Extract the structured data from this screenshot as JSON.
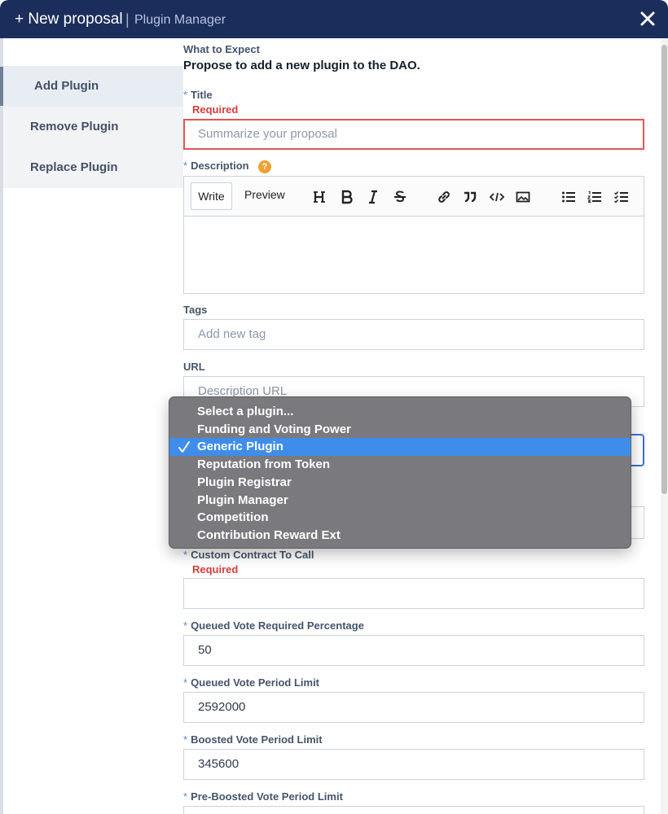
{
  "header": {
    "title": "+ New proposal",
    "separator": "|",
    "subtitle": "Plugin Manager",
    "close_icon": "close-icon"
  },
  "sidebar": {
    "items": [
      {
        "label": "Add Plugin",
        "active": true
      },
      {
        "label": "Remove Plugin",
        "active": false
      },
      {
        "label": "Replace Plugin",
        "active": false
      }
    ]
  },
  "intro": {
    "heading": "What to Expect",
    "text": "Propose to add a new plugin to the DAO."
  },
  "fields": {
    "title": {
      "label": "Title",
      "required_text": "Required",
      "placeholder": "Summarize your proposal"
    },
    "description": {
      "label": "Description",
      "help_icon": "help-icon",
      "help_glyph": "?"
    },
    "tags": {
      "label": "Tags",
      "placeholder": "Add new tag"
    },
    "url": {
      "label": "URL",
      "placeholder": "Description URL"
    },
    "custom_contract": {
      "label": "Custom Contract To Call",
      "required_text": "Required",
      "value": ""
    },
    "queued_vote_required_percentage": {
      "label": "Queued Vote Required Percentage",
      "value": "50"
    },
    "queued_vote_period_limit": {
      "label": "Queued Vote Period Limit",
      "value": "2592000"
    },
    "boosted_vote_period_limit": {
      "label": "Boosted Vote Period Limit",
      "value": "345600"
    },
    "pre_boosted_vote_period_limit": {
      "label": "Pre-Boosted Vote Period Limit",
      "value": ""
    }
  },
  "required_star": "*",
  "editor": {
    "write_tab": "Write",
    "preview_tab": "Preview",
    "toolbar_icons": [
      "heading-icon",
      "bold-icon",
      "italic-icon",
      "strikethrough-icon",
      "link-icon",
      "quote-icon",
      "code-icon",
      "image-icon",
      "bullet-list-icon",
      "numbered-list-icon",
      "checklist-icon"
    ]
  },
  "plugin_dropdown": {
    "options": [
      "Select a plugin...",
      "Funding and Voting Power",
      "Generic Plugin",
      "Reputation from Token",
      "Plugin Registrar",
      "Plugin Manager",
      "Competition",
      "Contribution Reward Ext"
    ],
    "selected": "Generic Plugin"
  },
  "colors": {
    "header_bg": "#1b2d5b",
    "accent_blue": "#4f8ad9",
    "error_red": "#d93b3b",
    "selection_blue": "#3f8dea",
    "help_orange": "#f0a030"
  }
}
